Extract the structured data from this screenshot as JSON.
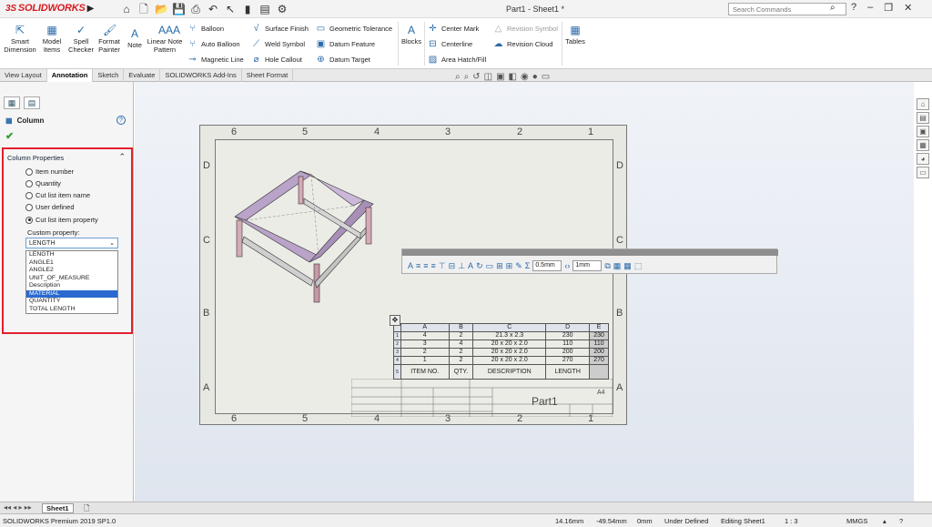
{
  "app": {
    "name": "SOLIDWORKS",
    "doc_title": "Part1 - Sheet1 *",
    "search_placeholder": "Search Commands"
  },
  "ribbon": {
    "smart_dimension": "Smart Dimension",
    "model_items": "Model Items",
    "spell_checker": "Spell Checker",
    "format_painter": "Format Painter",
    "note": "Note",
    "linear_note_pattern": "Linear Note Pattern",
    "balloon": "Balloon",
    "auto_balloon": "Auto Balloon",
    "magnetic_line": "Magnetic Line",
    "surface_finish": "Surface Finish",
    "weld_symbol": "Weld Symbol",
    "hole_callout": "Hole Callout",
    "geometric_tolerance": "Geometric Tolerance",
    "datum_feature": "Datum Feature",
    "datum_target": "Datum Target",
    "blocks": "Blocks",
    "center_mark": "Center Mark",
    "centerline": "Centerline",
    "area_hatch": "Area Hatch/Fill",
    "revision_symbol": "Revision Symbol",
    "revision_cloud": "Revision Cloud",
    "tables": "Tables"
  },
  "tabs": [
    "View Layout",
    "Annotation",
    "Sketch",
    "Evaluate",
    "SOLIDWORKS Add-Ins",
    "Sheet Format"
  ],
  "pm": {
    "title": "Column",
    "section": "Column Properties",
    "radios": [
      "Item number",
      "Quantity",
      "Cut list item name",
      "User defined",
      "Cut list item property"
    ],
    "selected_radio": 4,
    "custom_label": "Custom property:",
    "select_value": "LENGTH",
    "options": [
      "LENGTH",
      "ANGLE1",
      "ANGLE2",
      "UNIT_OF_MEASURE",
      "Description",
      "MATERIAL",
      "QUANTITY",
      "TOTAL LENGTH"
    ],
    "highlighted_option": "MATERIAL"
  },
  "drawing": {
    "zones_top": [
      "6",
      "5",
      "4",
      "3",
      "2",
      "1"
    ],
    "zones_side": [
      "D",
      "C",
      "B",
      "A"
    ],
    "table_toolbar": {
      "width": "0.5mm",
      "height": "1mm"
    },
    "bom_cols": [
      "A",
      "B",
      "C",
      "D",
      "E"
    ],
    "bom_rows": [
      [
        "4",
        "2",
        "21.3 x 2.3",
        "230",
        "230"
      ],
      [
        "3",
        "4",
        "20 x 20 x 2.0",
        "110",
        "110"
      ],
      [
        "2",
        "2",
        "20 x 20 x 2.0",
        "200",
        "200"
      ],
      [
        "1",
        "2",
        "20 x 20 x 2.0",
        "270",
        "270"
      ]
    ],
    "bom_row_nums": [
      "1",
      "2",
      "3",
      "4",
      "5"
    ],
    "bom_headers": [
      "ITEM NO.",
      "QTY.",
      "DESCRIPTION",
      "LENGTH",
      ""
    ],
    "part_name": "Part1",
    "sheet_size": "A4"
  },
  "sheet_tab": "Sheet1",
  "status": {
    "product": "SOLIDWORKS Premium 2019 SP1.0",
    "x": "14.16mm",
    "y": "-49.54mm",
    "z": "0mm",
    "def": "Under Defined",
    "editing": "Editing Sheet1",
    "scale": "1 : 3",
    "units": "MMGS"
  }
}
